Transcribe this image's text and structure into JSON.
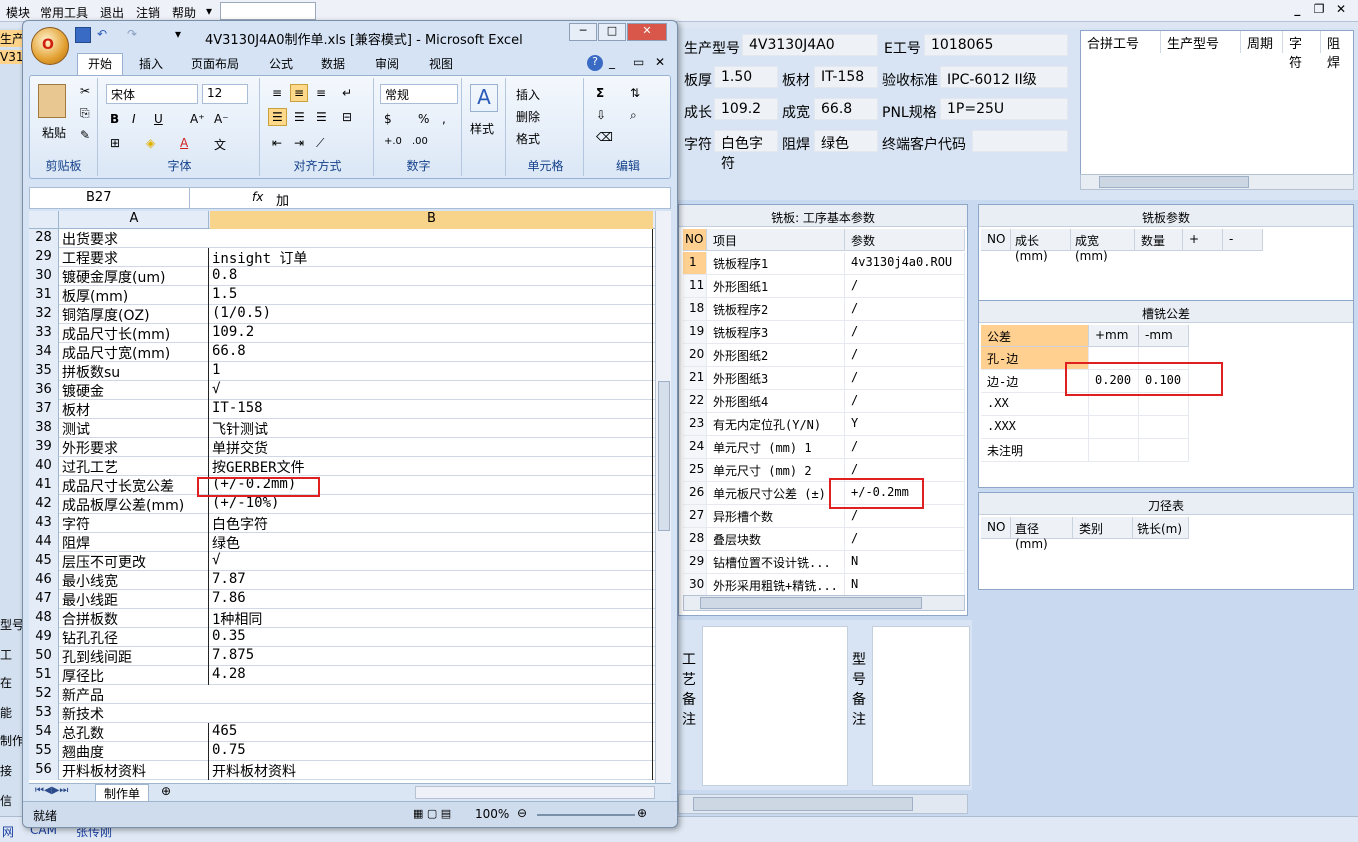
{
  "app": {
    "menu": [
      "模块",
      "常用工具",
      "退出",
      "注销",
      "帮助"
    ],
    "menu_arrow": "▾",
    "left_strip": [
      "生产",
      "V31",
      "型号",
      "工",
      "在",
      "能",
      "制作",
      "接",
      "信"
    ],
    "bottom_tabs": [
      "网",
      "CAM",
      "张传刚"
    ],
    "win_buttons": [
      "_",
      "❐",
      "✕"
    ]
  },
  "params": {
    "fields": [
      {
        "label": "生产型号",
        "value": "4V3130J4A0"
      },
      {
        "label": "E工号",
        "value": "1018065"
      },
      {
        "label": "板厚",
        "value": "1.50"
      },
      {
        "label": "板材",
        "value": "IT-158"
      },
      {
        "label": "验收标准",
        "value": "IPC-6012 II级"
      },
      {
        "label": "成长",
        "value": "109.2"
      },
      {
        "label": "成宽",
        "value": "66.8"
      },
      {
        "label": "PNL规格",
        "value": "1P=25U"
      },
      {
        "label": "字符",
        "value": "白色字符"
      },
      {
        "label": "阻焊",
        "value": "绿色"
      },
      {
        "label": "终端客户代码",
        "value": ""
      }
    ],
    "combine_headers": [
      "合拼工号",
      "生产型号",
      "周期",
      "字符",
      "阻焊"
    ]
  },
  "process_table": {
    "title": "铣板: 工序基本参数",
    "headers": [
      "NO",
      "项目",
      "参数"
    ],
    "rows": [
      {
        "no": "1",
        "item": "铣板程序1",
        "param": "4v3130j4a0.ROU"
      },
      {
        "no": "11",
        "item": "外形图纸1",
        "param": "/"
      },
      {
        "no": "18",
        "item": "铣板程序2",
        "param": "/"
      },
      {
        "no": "19",
        "item": "铣板程序3",
        "param": "/"
      },
      {
        "no": "20",
        "item": "外形图纸2",
        "param": "/"
      },
      {
        "no": "21",
        "item": "外形图纸3",
        "param": "/"
      },
      {
        "no": "22",
        "item": "外形图纸4",
        "param": "/"
      },
      {
        "no": "23",
        "item": "有无内定位孔(Y/N)",
        "param": "Y"
      },
      {
        "no": "24",
        "item": "单元尺寸 (mm) 1",
        "param": "/"
      },
      {
        "no": "25",
        "item": "单元尺寸 (mm) 2",
        "param": "/"
      },
      {
        "no": "26",
        "item": "单元板尺寸公差 (±)",
        "param": "+/-0.2mm"
      },
      {
        "no": "27",
        "item": "异形槽个数",
        "param": "/"
      },
      {
        "no": "28",
        "item": "叠层块数",
        "param": "/"
      },
      {
        "no": "29",
        "item": "钻槽位置不设计铣...",
        "param": "N"
      },
      {
        "no": "30",
        "item": "外形采用粗铣+精铣...",
        "param": "N"
      }
    ]
  },
  "mill_params": {
    "title": "铣板参数",
    "headers": [
      "NO",
      "成长(mm)",
      "成宽(mm)",
      "数量",
      "+",
      "-"
    ]
  },
  "tolerance": {
    "title": "槽铣公差",
    "headers": [
      "公差",
      "+mm",
      "-mm"
    ],
    "rows": [
      {
        "name": "孔-边",
        "plus": "",
        "minus": ""
      },
      {
        "name": "边-边",
        "plus": "0.200",
        "minus": "0.100"
      },
      {
        "name": ".XX",
        "plus": "",
        "minus": ""
      },
      {
        "name": ".XXX",
        "plus": "",
        "minus": ""
      },
      {
        "name": "未注明",
        "plus": "",
        "minus": ""
      }
    ]
  },
  "tool_table": {
    "title": "刀径表",
    "headers": [
      "NO",
      "直径(mm)",
      "类别",
      "铣长(m)"
    ]
  },
  "notes": {
    "process_note_label": "工艺备注",
    "model_note_label": "型号备注"
  },
  "excel": {
    "title": "4V3130J4A0制作单.xls  [兼容模式] - Microsoft Excel",
    "office_logo": "O",
    "tabs": [
      "开始",
      "插入",
      "页面布局",
      "公式",
      "数据",
      "审阅",
      "视图"
    ],
    "help_icon": "?",
    "ribbon": {
      "clipboard": {
        "paste": "粘贴",
        "label": "剪贴板"
      },
      "font": {
        "name": "宋体",
        "size": "12",
        "label": "字体",
        "bold": "B",
        "italic": "I",
        "underline": "U"
      },
      "align": {
        "label": "对齐方式"
      },
      "number": {
        "format": "常规",
        "label": "数字",
        "percent": "%",
        "comma": ","
      },
      "styles": {
        "label": "样式"
      },
      "cells": {
        "insert": "插入",
        "delete": "删除",
        "format": "格式",
        "label": "单元格"
      },
      "edit": {
        "label": "编辑",
        "sum": "Σ"
      }
    },
    "name_box": "B27",
    "fx": "fx",
    "formula": "加",
    "col_a": "A",
    "col_b": "B",
    "rows": [
      {
        "n": "28",
        "a": "出货要求",
        "b": ""
      },
      {
        "n": "29",
        "a": "工程要求",
        "b": "insight 订单"
      },
      {
        "n": "30",
        "a": "镀硬金厚度(um)",
        "b": "0.8"
      },
      {
        "n": "31",
        "a": "板厚(mm)",
        "b": "1.5"
      },
      {
        "n": "32",
        "a": "铜箔厚度(OZ)",
        "b": " (1/0.5)"
      },
      {
        "n": "33",
        "a": "成品尺寸长(mm)",
        "b": "109.2"
      },
      {
        "n": "34",
        "a": "成品尺寸宽(mm)",
        "b": "66.8"
      },
      {
        "n": "35",
        "a": "拼板数su",
        "b": "1"
      },
      {
        "n": "36",
        "a": "镀硬金",
        "b": "√"
      },
      {
        "n": "37",
        "a": "板材",
        "b": "IT-158"
      },
      {
        "n": "38",
        "a": "测试",
        "b": "飞针测试"
      },
      {
        "n": "39",
        "a": "外形要求",
        "b": "单拼交货"
      },
      {
        "n": "40",
        "a": "过孔工艺",
        "b": "按GERBER文件"
      },
      {
        "n": "41",
        "a": "成品尺寸长宽公差",
        "b": "(+/-0.2mm)"
      },
      {
        "n": "42",
        "a": "成品板厚公差(mm)",
        "b": "(+/-10%)"
      },
      {
        "n": "43",
        "a": "字符",
        "b": "白色字符"
      },
      {
        "n": "44",
        "a": "阻焊",
        "b": "绿色"
      },
      {
        "n": "45",
        "a": "层压不可更改",
        "b": "√"
      },
      {
        "n": "46",
        "a": "最小线宽",
        "b": "7.87"
      },
      {
        "n": "47",
        "a": "最小线距",
        "b": "7.86"
      },
      {
        "n": "48",
        "a": "合拼板数",
        "b": "1种相同"
      },
      {
        "n": "49",
        "a": "钻孔孔径",
        "b": "0.35"
      },
      {
        "n": "50",
        "a": "孔到线间距",
        "b": "7.875"
      },
      {
        "n": "51",
        "a": "厚径比",
        "b": "4.28"
      },
      {
        "n": "52",
        "a": "新产品",
        "b": ""
      },
      {
        "n": "53",
        "a": "新技术",
        "b": ""
      },
      {
        "n": "54",
        "a": "总孔数",
        "b": "465"
      },
      {
        "n": "55",
        "a": "翘曲度",
        "b": "0.75"
      },
      {
        "n": "56",
        "a": "开料板材资料",
        "b": "开料板材资料"
      }
    ],
    "sheet_tab": "制作单",
    "status": "就绪",
    "zoom": "100%"
  }
}
